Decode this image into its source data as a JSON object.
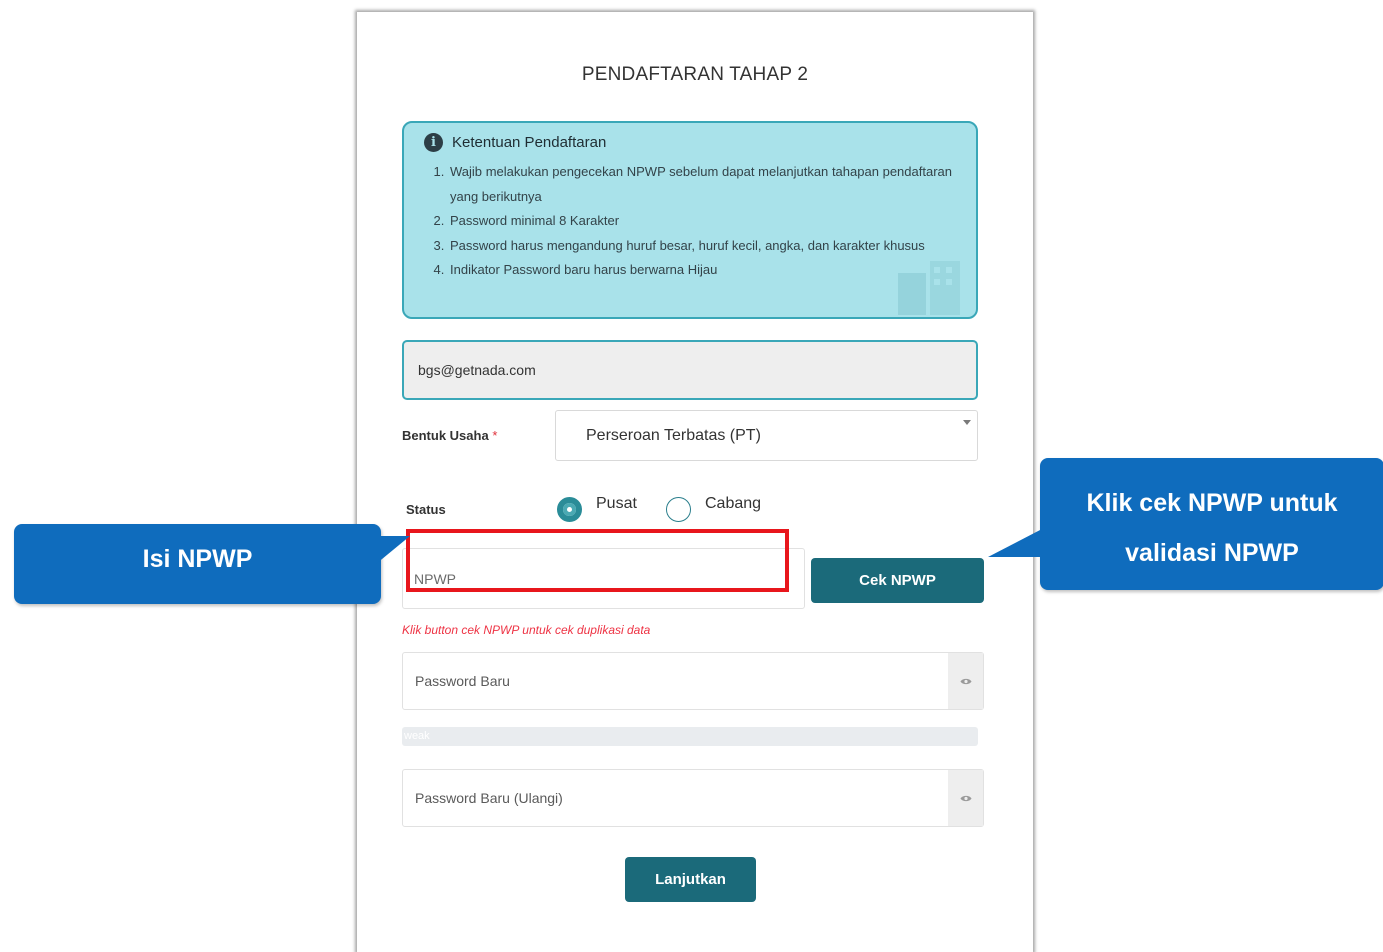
{
  "form": {
    "title": "PENDAFTARAN TAHAP 2",
    "info": {
      "heading": "Ketentuan Pendaftaran",
      "items": [
        "Wajib melakukan pengecekan NPWP sebelum dapat melanjutkan tahapan pendaftaran yang berikutnya",
        "Password minimal 8 Karakter",
        "Password harus mengandung huruf besar, huruf kecil, angka, dan karakter khusus",
        "Indikator Password baru harus berwarna Hijau"
      ]
    },
    "email": "bgs@getnada.com",
    "bentuk_usaha": {
      "label": "Bentuk Usaha",
      "required_mark": "*",
      "value": "Perseroan Terbatas (PT)"
    },
    "status": {
      "label": "Status",
      "options": [
        "Pusat",
        "Cabang"
      ],
      "selected": "Pusat"
    },
    "npwp": {
      "placeholder": "NPWP",
      "button_label": "Cek NPWP",
      "hint": "Klik button cek NPWP untuk cek duplikasi data"
    },
    "password": {
      "placeholder": "Password Baru",
      "strength_label": "weak",
      "confirm_placeholder": "Password Baru (Ulangi)"
    },
    "submit_label": "Lanjutkan"
  },
  "annotations": {
    "left_callout": "Isi NPWP",
    "right_callout_line1": "Klik  cek NPWP untuk",
    "right_callout_line2": "validasi NPWP",
    "highlight_color": "#e8161c",
    "callout_color": "#0f6cbd"
  },
  "colors": {
    "primary_button": "#1b6a7a",
    "info_bg": "#a9e2ea",
    "info_border": "#3aa7b8",
    "hint_text": "#ee3344"
  },
  "icons": {
    "info": "info-circle-icon",
    "password_toggle": "eye-icon",
    "select": "caret-down-icon"
  }
}
